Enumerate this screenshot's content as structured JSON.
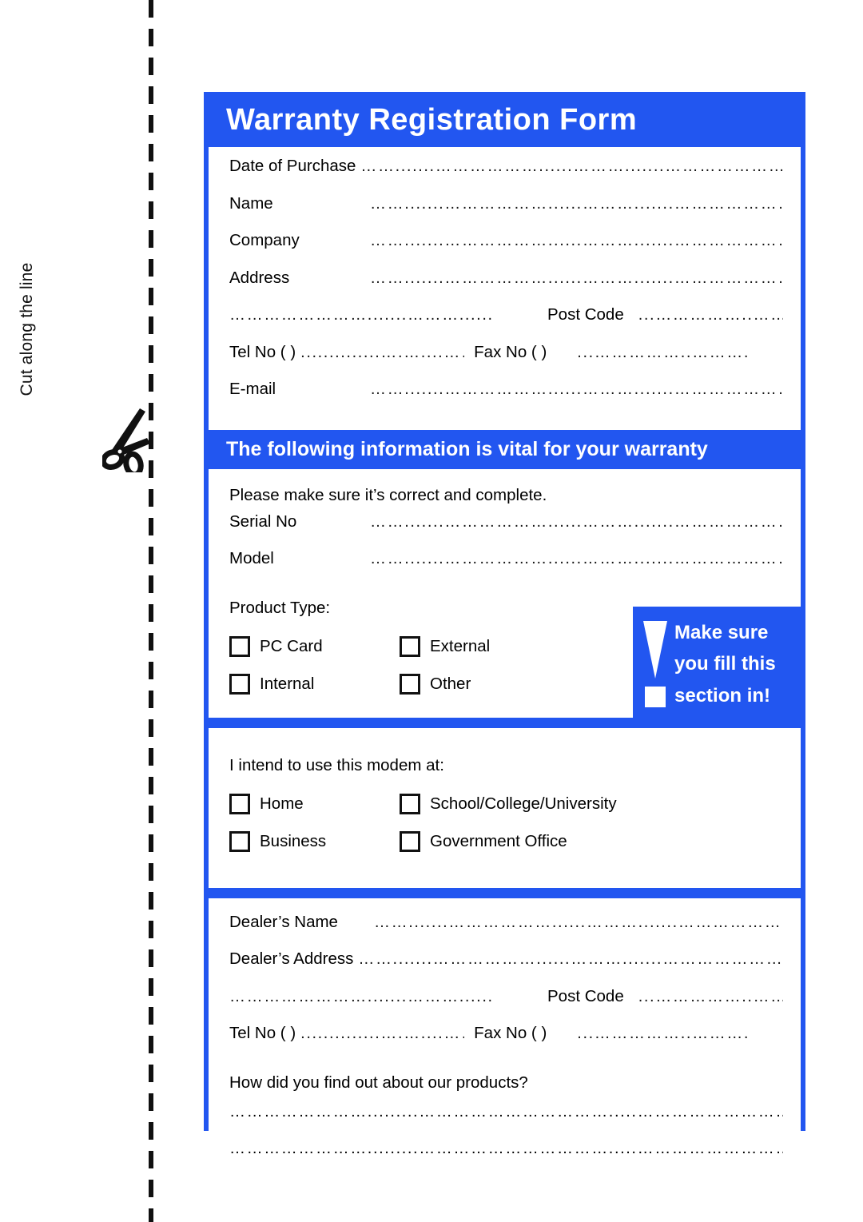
{
  "cut_strip": {
    "label": "Cut along the line",
    "scissors_icon": "scissors-icon"
  },
  "form": {
    "title": "Warranty Registration Form",
    "accent_color": "#2256f0",
    "dots_short": "…….......………………......……….......…………………….........",
    "dots_medium": "…….......………………......………........................",
    "dots_tel": "..............….…....…….",
    "dots_fax": "...……………..……….",
    "dots_postcode": "...……………..……….",
    "dots_halfline": "…………………….......………..........",
    "dots_full": "…………………….........…………………………….....…………………………………………………….....…………….",
    "customer_section": {
      "rows": [
        {
          "label": "Date of Purchase",
          "inline": true
        },
        {
          "label": "Name",
          "inline": false
        },
        {
          "label": "Company",
          "inline": false
        },
        {
          "label": "Address",
          "inline": false
        }
      ],
      "post_code_label": "Post Code",
      "tel_label": "Tel  No (     )",
      "fax_label": "Fax No (     )",
      "email_label": "E-mail"
    },
    "vital_section": {
      "header": "The following information is vital for your warranty",
      "note": "Please make sure it’s correct and complete.",
      "serial_label": "Serial No",
      "model_label": "Model",
      "product_type_label": "Product Type:",
      "product_types": [
        "PC Card",
        "External",
        "Internal",
        "Other"
      ],
      "callout": {
        "line1": "Make  sure",
        "line2": "you fill this",
        "line3": "section in!",
        "icon": "exclamation-icon"
      }
    },
    "usage_section": {
      "question": "I intend to use this modem at:",
      "options": [
        "Home",
        "School/College/University",
        "Business",
        "Government  Office"
      ]
    },
    "dealer_section": {
      "name_label": "Dealer’s Name",
      "address_label": "Dealer’s  Address",
      "post_code_label": "Post Code",
      "tel_label": "Tel  No (     )",
      "fax_label": "Fax No (     )",
      "how_found_label": "How did you find out about our products?"
    }
  }
}
